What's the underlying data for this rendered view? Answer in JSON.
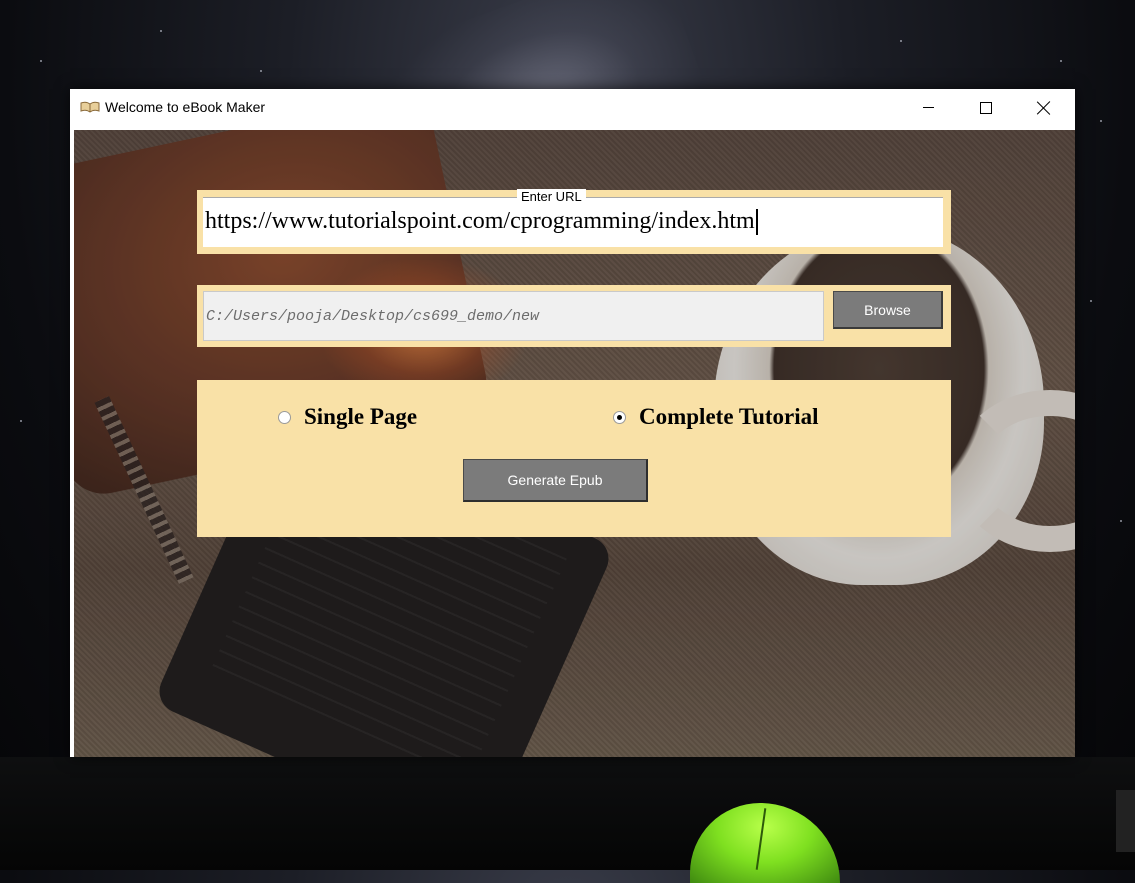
{
  "window": {
    "title": "Welcome to eBook Maker",
    "icon": "book-icon"
  },
  "url_section": {
    "label": "Enter URL",
    "value": "https://www.tutorialspoint.com/cprogramming/index.htm"
  },
  "path_section": {
    "value": "C:/Users/pooja/Desktop/cs699_demo/new",
    "browse_label": "Browse"
  },
  "options": {
    "single_label": "Single Page",
    "complete_label": "Complete Tutorial",
    "selected": "Complete Tutorial",
    "generate_label": "Generate Epub"
  },
  "colors": {
    "panel": "#f9e1a7",
    "button": "#7b7b7b"
  }
}
